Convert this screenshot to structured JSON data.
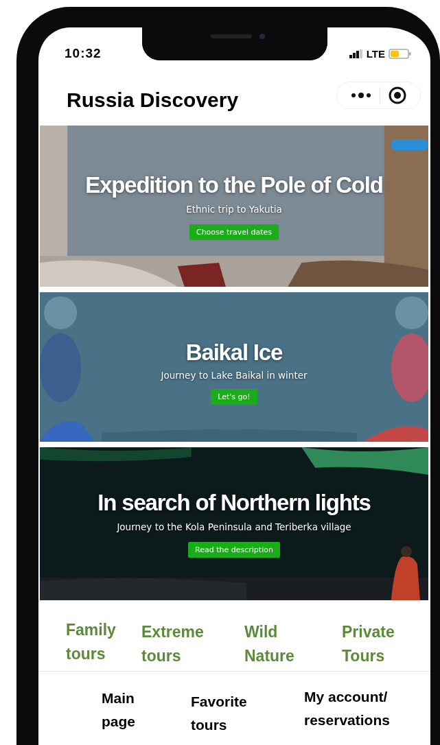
{
  "status_bar": {
    "time": "10:32",
    "network": "LTE"
  },
  "header": {
    "title": "Russia Discovery"
  },
  "banners": [
    {
      "title": "Expedition to the Pole of Cold",
      "subtitle": "Ethnic trip to Yakutia",
      "button": "Choose travel dates",
      "kind": "picture"
    },
    {
      "title": "Baikal Ice",
      "subtitle": "Journey to Lake Baikal in winter",
      "button": "Let's go!",
      "kind": "picture"
    },
    {
      "title": "In search of Northern lights",
      "subtitle": "Journey to the Kola Peninsula and Teriberka village",
      "button": "Read the description",
      "kind": "picture"
    }
  ],
  "categories": [
    "Family tours",
    "Extreme tours",
    "Wild Nature",
    "Private Tours"
  ],
  "tab_bar": [
    "Main page",
    "Favorite tours",
    "My account/ reservations"
  ]
}
